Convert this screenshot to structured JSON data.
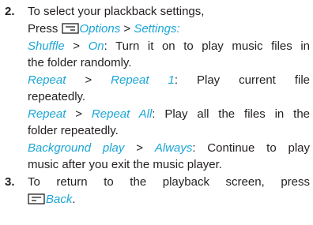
{
  "step2": {
    "number": "2.",
    "intro": "To select your plackback settings,",
    "press_word": "Press",
    "options_label": "Options",
    "gt": ">",
    "settings_label": "Settings",
    "colon": ":",
    "shuffle_label": "Shuffle",
    "on_label": "On",
    "shuffle_desc_1": ": Turn it on to play music files in",
    "shuffle_desc_2": "the folder randomly.",
    "repeat_label": "Repeat",
    "repeat1_label": "Repeat 1",
    "repeat1_desc_1": ": Play current file",
    "repeat1_desc_2": "repeatedly.",
    "repeatall_label": "Repeat All",
    "repeatall_desc_1": ": Play all the files in the",
    "repeatall_desc_2": "folder repeatedly.",
    "background_label": "Background play",
    "always_label": "Always",
    "background_desc_1": ": Continue to play",
    "background_desc_2": "music after you exit the music player."
  },
  "step3": {
    "number": "3.",
    "text_1": "To return to the playback screen, press",
    "back_label": "Back",
    "period": "."
  },
  "icons": {
    "left_softkey": "left-softkey-icon",
    "right_softkey": "right-softkey-icon"
  },
  "colors": {
    "accent": "#1ba6d6",
    "text": "#231f20"
  }
}
